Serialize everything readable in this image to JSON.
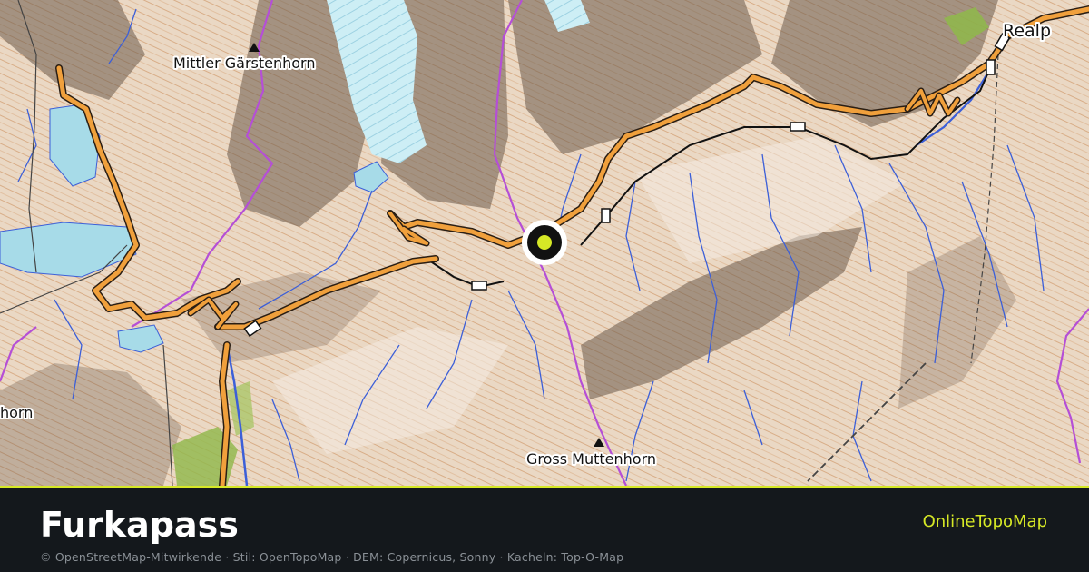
{
  "map": {
    "labels": {
      "mittler": "Mittler Gärstenhorn",
      "realp": "Realp",
      "gross": "Gross Muttenhorn",
      "edge": "horn"
    },
    "marker": {
      "color": "#d6e826"
    },
    "colors": {
      "terrain": "#e8d6c2",
      "road": "#f0a03c",
      "water": "#a7dbe8",
      "glacier": "#cdeef5",
      "stream": "#3c5fd8",
      "boundary": "#b54fd6",
      "forest": "#9fc15a"
    }
  },
  "footer": {
    "title": "Furkapass",
    "brand": "OnlineTopoMap",
    "attribution": "© OpenStreetMap-Mitwirkende · Stil: OpenTopoMap · DEM: Copernicus, Sonny · Kacheln: Top-O-Map"
  }
}
